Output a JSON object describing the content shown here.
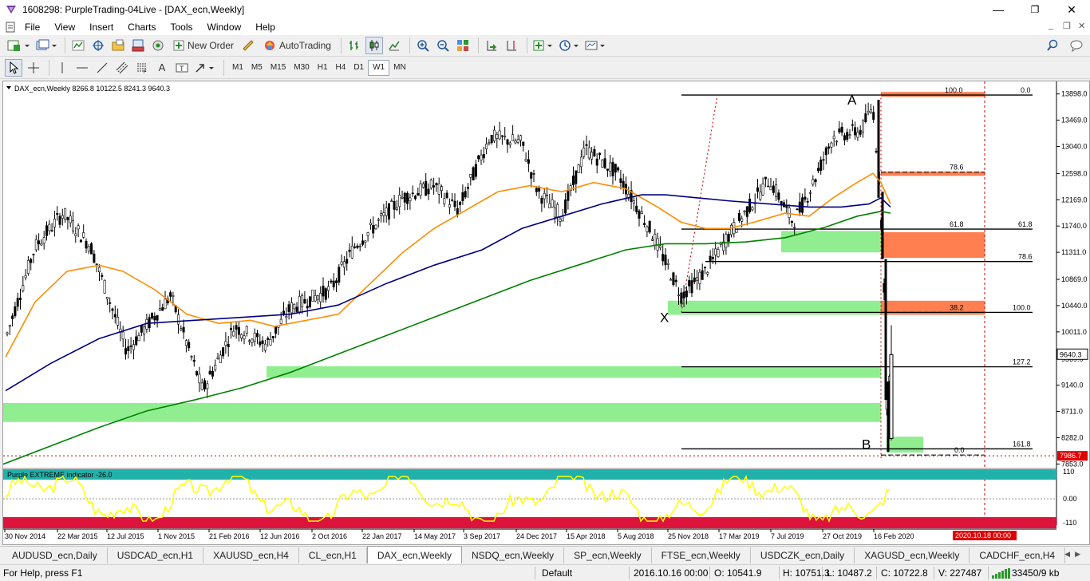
{
  "window": {
    "title": "1608298: PurpleTrading-04Live - [DAX_ecn,Weekly]",
    "minimize": "—",
    "restore": "❐",
    "close": "✕"
  },
  "menu": [
    "File",
    "View",
    "Insert",
    "Charts",
    "Tools",
    "Window",
    "Help"
  ],
  "toolbar": {
    "new_order": "New Order",
    "auto_trading": "AutoTrading",
    "timeframes": [
      "M1",
      "M5",
      "M15",
      "M30",
      "H1",
      "H4",
      "D1",
      "W1",
      "MN"
    ],
    "active_timeframe": "W1"
  },
  "chart": {
    "header": "DAX_ecn,Weekly  8266.8 10122.5 8241.3 9640.3",
    "current_price": "9640.3",
    "line_price": "7986.7",
    "price_ticks": [
      "13898.0",
      "13469.0",
      "13040.0",
      "12598.0",
      "12169.0",
      "11740.0",
      "11311.0",
      "10869.0",
      "10440.0",
      "10011.0",
      "9569.0",
      "9140.0",
      "8711.0",
      "8282.0",
      "7853.0"
    ],
    "fib_labels": {
      "top_100": "100.0",
      "top_0": "0.0",
      "mid_786": "78.6",
      "r_618": "61.8",
      "r_786": "78.6",
      "r_100": "100.0",
      "mid_382": "38.2",
      "r_1272": "127.2",
      "r_1618": "161.8",
      "low_0": "0.0"
    },
    "pattern_points": {
      "A": "A",
      "X": "X",
      "B": "B"
    },
    "indicator": {
      "label": "Purple EXTREME indicator -26.0",
      "ticks": [
        "110",
        "0.00",
        "-110"
      ]
    },
    "date_ticks": [
      "30 Nov 2014",
      "22 Mar 2015",
      "12 Jul 2015",
      "1 Nov 2015",
      "21 Feb 2016",
      "12 Jun 2016",
      "2 Oct 2016",
      "22 Jan 2017",
      "14 May 2017",
      "3 Sep 2017",
      "24 Dec 2017",
      "15 Apr 2018",
      "5 Aug 2018",
      "25 Nov 2018",
      "17 Mar 2019",
      "7 Jul 2019",
      "27 Oct 2019",
      "16 Feb 2020"
    ],
    "date_marker": "2020.10.18 00:00",
    "colors": {
      "ma_fast": "#ff8c00",
      "ma_mid": "#000080",
      "ma_slow": "#008000",
      "zone_green": "#90ee90",
      "zone_orange": "#ff7f50",
      "indicator_top": "#20b2aa",
      "indicator_bottom": "#dc143c",
      "indicator_line": "#ffff00"
    }
  },
  "tabs": [
    "AUDUSD_ecn,Daily",
    "USDCAD_ecn,H1",
    "XAUUSD_ecn,H4",
    "CL_ecn,H1",
    "DAX_ecn,Weekly",
    "NSDQ_ecn,Weekly",
    "SP_ecn,Weekly",
    "FTSE_ecn,Weekly",
    "USDCZK_ecn,Daily",
    "XAGUSD_ecn,Weekly",
    "CADCHF_ecn,H4"
  ],
  "active_tab": "DAX_ecn,Weekly",
  "status": {
    "help": "For Help, press F1",
    "profile": "Default",
    "datetime": "2016.10.16 00:00",
    "open": "O: 10541.9",
    "high": "H: 10751.3",
    "low": "L: 10487.2",
    "close": "C: 10722.8",
    "volume": "V: 227487",
    "traffic": "33450/9 kb"
  }
}
